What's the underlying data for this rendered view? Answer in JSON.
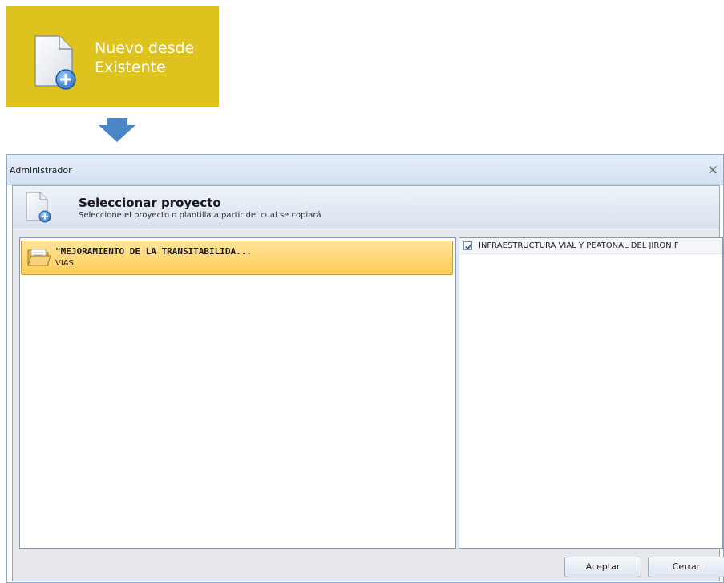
{
  "ribbon": {
    "label_line1": "Nuevo desde",
    "label_line2": "Existente",
    "icon": "new-document-plus-icon",
    "background": "#dec21e"
  },
  "arrow": {
    "icon": "down-arrow-icon",
    "color": "#4a86c6"
  },
  "dialog": {
    "title": "Administrador",
    "close_icon": "close-icon",
    "header": {
      "title": "Seleccionar proyecto",
      "subtitle": "Seleccione el proyecto o plantilla a partir del cual se copiará",
      "icon": "new-document-plus-icon"
    },
    "projects": [
      {
        "name": "\"MEJORAMIENTO DE LA TRANSITABILIDA...",
        "sub": "VIAS",
        "icon": "folder-icon",
        "selected": true
      }
    ],
    "subprojects": [
      {
        "label": "INFRAESTRUCTURA VIAL Y PEATONAL DEL JIRON F",
        "checked": true
      }
    ],
    "buttons": {
      "accept": "Aceptar",
      "close": "Cerrar"
    }
  }
}
